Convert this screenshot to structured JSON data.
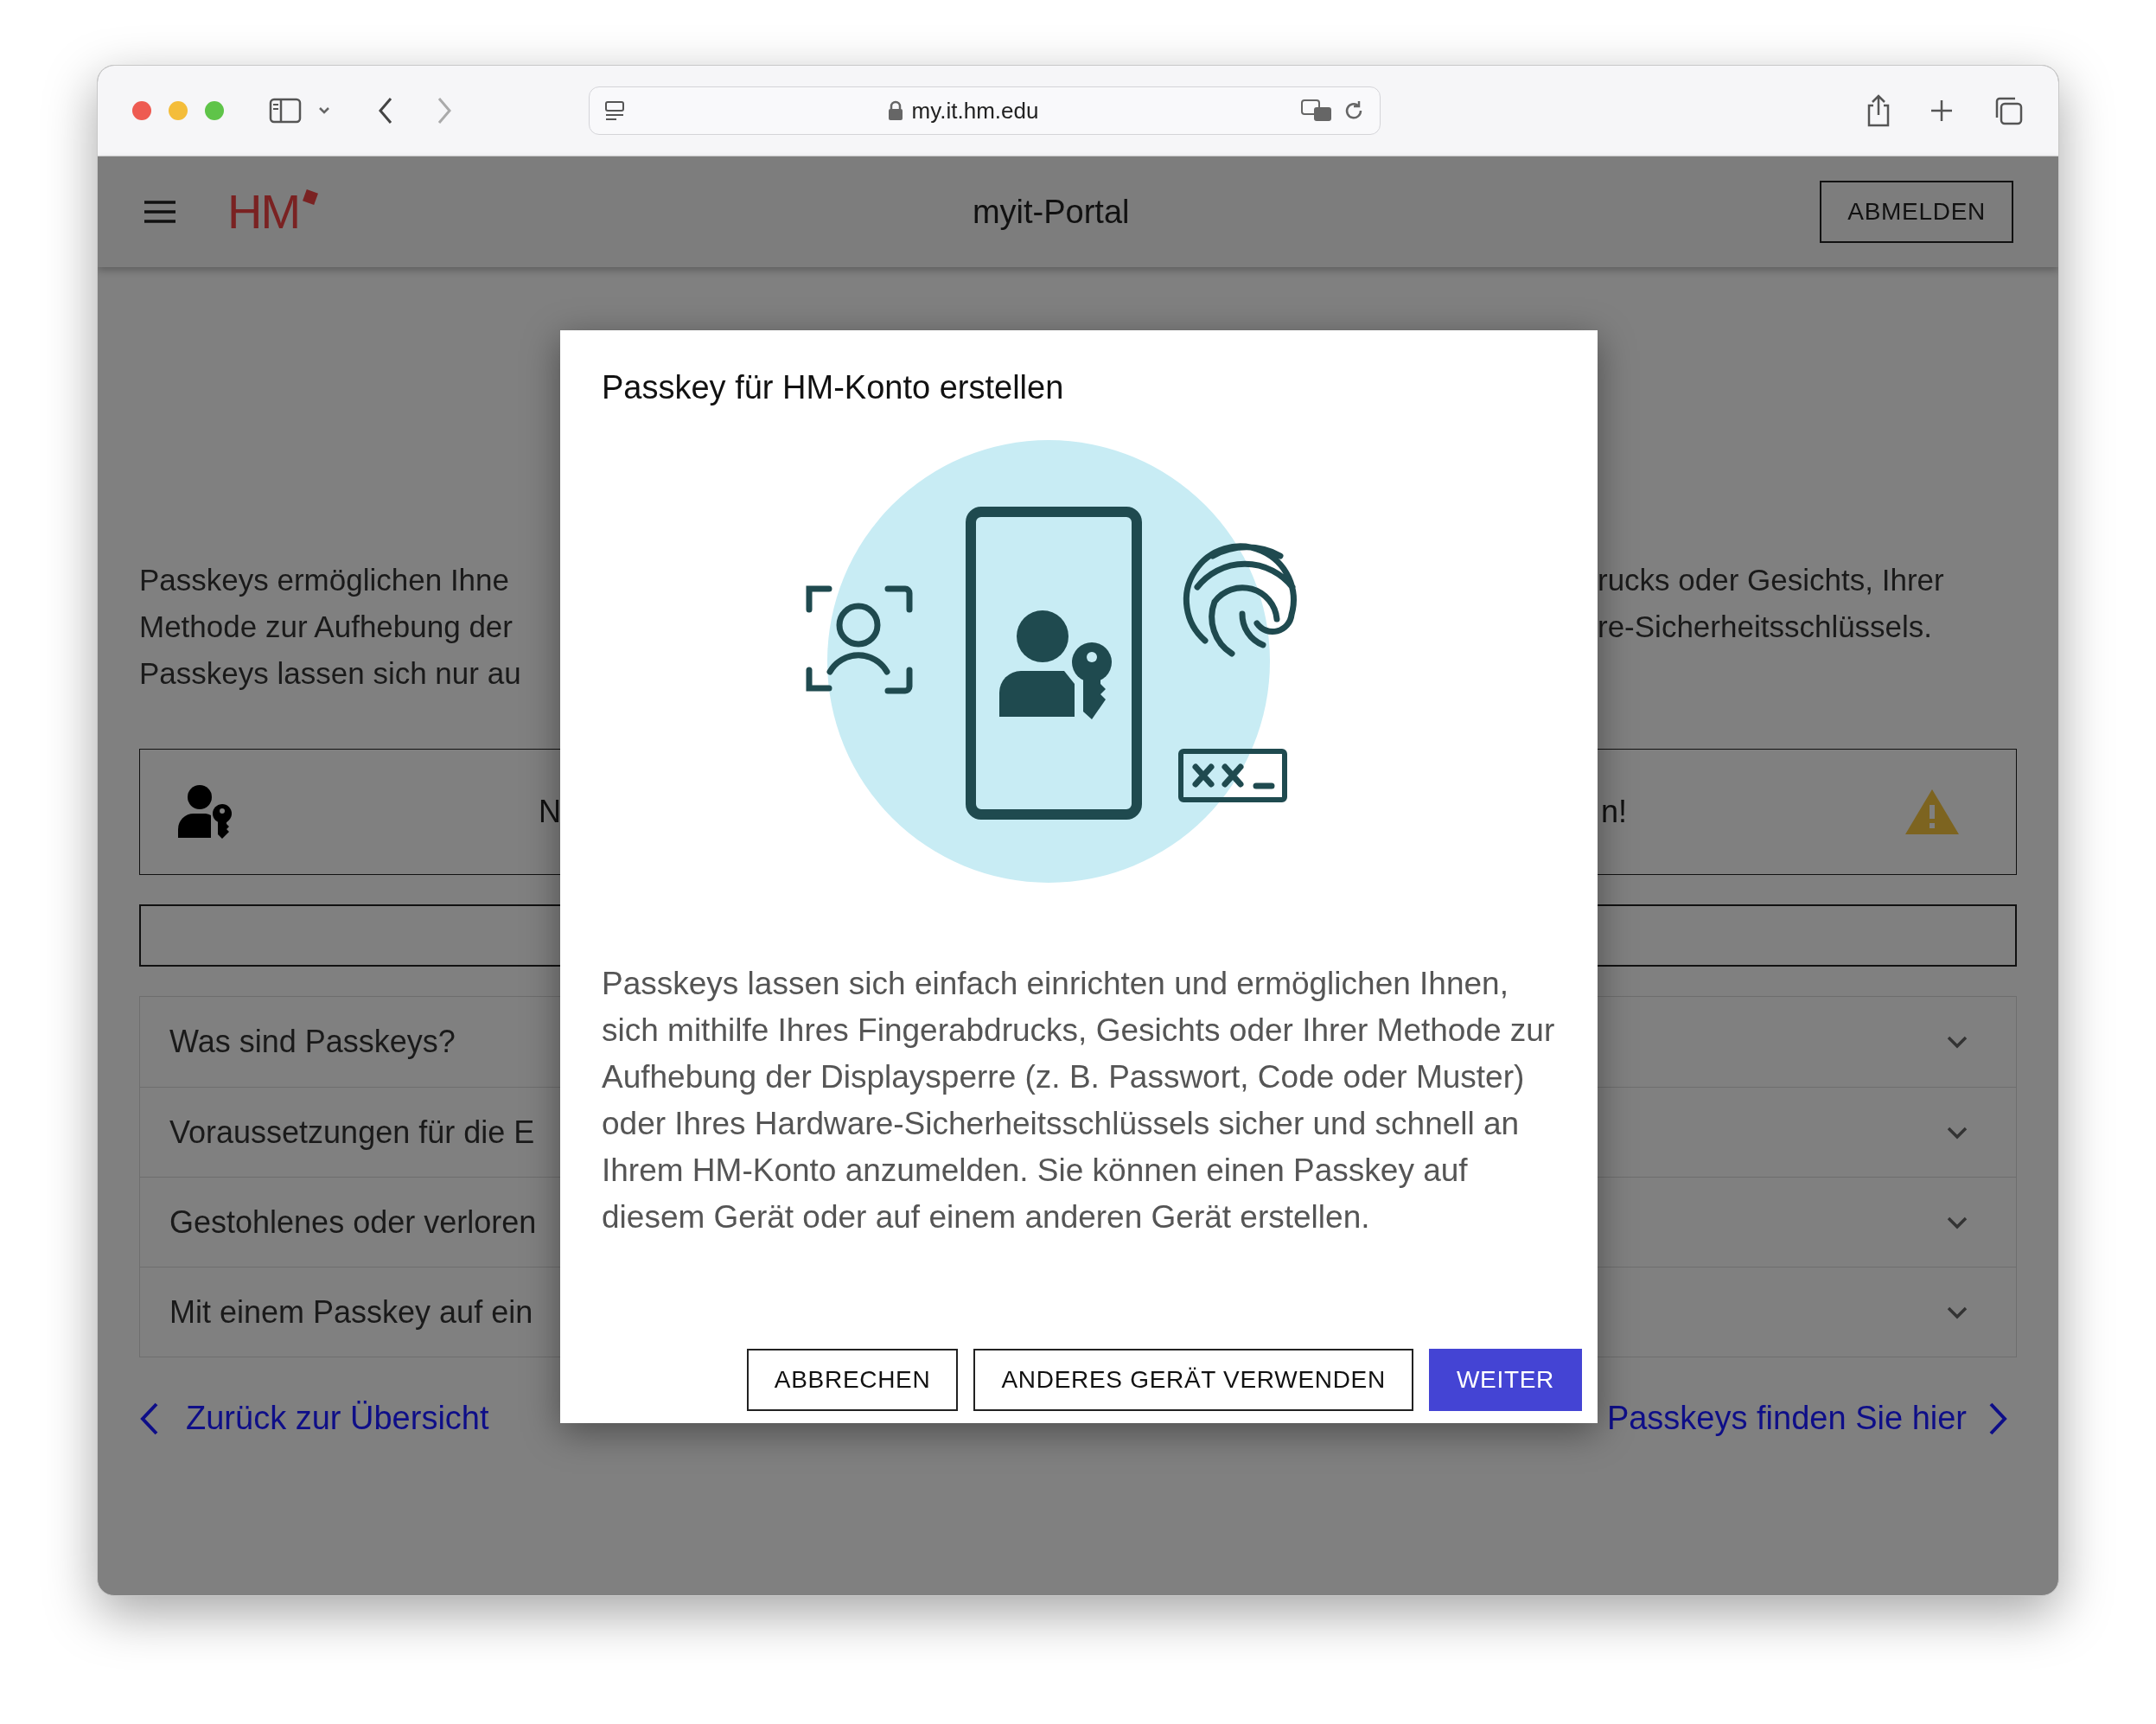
{
  "browser": {
    "url": "my.it.hm.edu"
  },
  "header": {
    "logo": "HM",
    "title": "myit-Portal",
    "logout": "ABMELDEN"
  },
  "page": {
    "intro_left": [
      "Passkeys ermöglichen Ihne",
      "Methode zur Aufhebung der",
      "Passkeys lassen sich nur au"
    ],
    "intro_right": [
      "rucks oder Gesichts, Ihrer",
      "re-Sicherheitsschlüssels."
    ],
    "notice_left": "N",
    "notice_right": "n!",
    "accordion": [
      {
        "label": "Was sind Passkeys?"
      },
      {
        "label": "Voraussetzungen für die E"
      },
      {
        "label": "Gestohlenes oder verloren"
      },
      {
        "label": "Mit einem Passkey auf ein"
      }
    ],
    "back_link": "Zurück zur Übersicht",
    "more_link": "Passkeys finden Sie hier"
  },
  "dialog": {
    "title": "Passkey für HM-Konto erstellen",
    "body": "Passkeys lassen sich einfach einrichten und ermöglichen Ihnen, sich mithilfe Ihres Fingerabdrucks, Gesichts oder Ihrer Methode zur Aufhebung der Displaysperre (z. B. Passwort, Code oder Muster) oder Ihres Hardware-Sicherheitsschlüssels sicher und schnell an Ihrem HM-Konto anzumelden. Sie können einen Passkey auf diesem Gerät oder auf einem anderen Gerät erstellen.",
    "buttons": [
      {
        "label": "ABBRECHEN",
        "kind": "outline"
      },
      {
        "label": "ANDERES GERÄT VERWENDEN",
        "kind": "outline"
      },
      {
        "label": "WEITER",
        "kind": "primary"
      }
    ]
  }
}
